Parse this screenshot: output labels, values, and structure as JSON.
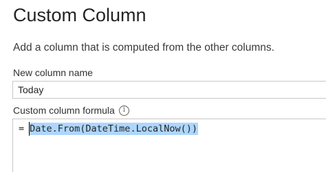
{
  "dialog": {
    "title": "Custom Column",
    "description": "Add a column that is computed from the other columns."
  },
  "column_name": {
    "label": "New column name",
    "value": "Today"
  },
  "formula": {
    "label": "Custom column formula",
    "info_icon_glyph": "i",
    "prefix": "=",
    "text": "Date.From(DateTime.LocalNow())",
    "selection_color": "#add6ff"
  },
  "icons": {
    "info": "info-icon"
  }
}
